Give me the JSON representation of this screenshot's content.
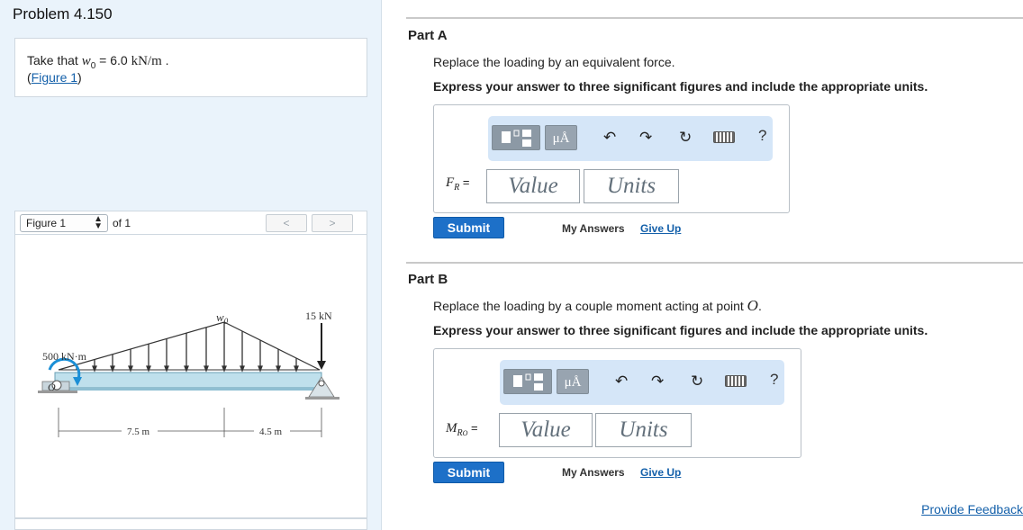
{
  "problem": {
    "title": "Problem 4.150",
    "given_prefix": "Take that ",
    "given_var": "w",
    "given_sub": "0",
    "given_mid": " = 6.0 ",
    "given_unit": "kN/m",
    "given_end": " .",
    "figure_link_open": "(",
    "figure_link": "Figure 1",
    "figure_link_close": ")"
  },
  "figure_nav": {
    "selected": "Figure 1",
    "of_label": "of 1",
    "prev_symbol": "<",
    "next_symbol": ">"
  },
  "figure": {
    "load_label": "w",
    "load_sub": "0",
    "force_label": "15 kN",
    "moment_label": "500 kN·m",
    "support_label": "O",
    "dim1": "7.5 m",
    "dim2": "4.5 m"
  },
  "part_a": {
    "title": "Part A",
    "instruction": "Replace the loading by an equivalent force.",
    "express": "Express your answer to three significant figures and include the appropriate units.",
    "var": "F",
    "var_sub": "R",
    "equals": " =",
    "value_placeholder": "Value",
    "units_placeholder": "Units",
    "submit": "Submit",
    "my_answers": "My Answers",
    "give_up": "Give Up"
  },
  "part_b": {
    "title": "Part B",
    "instruction": "Replace the loading by a couple moment acting at point ",
    "instruction_point": "O",
    "instruction_end": ".",
    "express": "Express your answer to three significant figures and include the appropriate units.",
    "var": "M",
    "var_sub": "R",
    "var_subsub": "O",
    "equals": " =",
    "value_placeholder": "Value",
    "units_placeholder": "Units",
    "submit": "Submit",
    "my_answers": "My Answers",
    "give_up": "Give Up"
  },
  "toolbar": {
    "mu_label": "μÅ",
    "undo": "↶",
    "redo": "↷",
    "reset": "↻",
    "help": "?"
  },
  "footer": {
    "feedback": "Provide Feedback"
  }
}
